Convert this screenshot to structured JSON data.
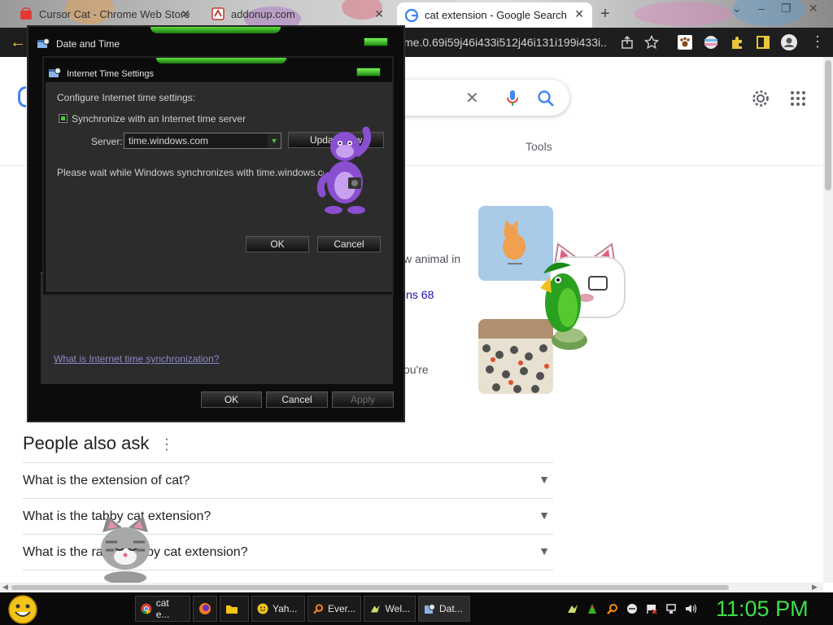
{
  "browser": {
    "tabs": [
      {
        "label": "Cursor Cat - Chrome Web Store",
        "active": false
      },
      {
        "label": "addonup.com",
        "active": false
      },
      {
        "label": "cat extension - Google Search",
        "active": true
      }
    ],
    "new_tab": "+",
    "window_controls": [
      "–",
      "❐",
      "✕"
    ],
    "url_fragment": "me.0.69i59j46i433i512j46i131i199i433i..."
  },
  "search": {
    "tools_label": "Tools",
    "clear_icon": "✕"
  },
  "result_snippets": [
    {
      "text": "w animal in",
      "link": false
    },
    {
      "text": "ins 68",
      "link": true
    },
    {
      "text": "ou're",
      "link": false
    }
  ],
  "people_also_ask": {
    "title": "People also ask",
    "menu": "⋮",
    "questions": [
      "What is the extension of cat?",
      "What is the tabby cat extension?",
      "What is the rarest tabby cat extension?"
    ]
  },
  "date_time_dialog": {
    "title": "Date and Time",
    "ok_label": "OK",
    "cancel_label": "Cancel",
    "apply_label": "Apply",
    "help_link": "What is Internet time synchronization?"
  },
  "internet_time_dialog": {
    "title": "Internet Time Settings",
    "heading": "Configure Internet time settings:",
    "sync_checkbox_label": "Synchronize with an Internet time server",
    "sync_checked": true,
    "server_label": "Server:",
    "server_value": "time.windows.com",
    "update_button": "Update now",
    "status_text": "Please wait while Windows synchronizes with time.windows.com.",
    "ok_label": "OK",
    "cancel_label": "Cancel"
  },
  "taskbar": {
    "buttons": [
      {
        "label": "cat e...",
        "icon": "chrome-icon"
      },
      {
        "label": "",
        "icon": "firefox-icon"
      },
      {
        "label": "",
        "icon": "folder-icon"
      },
      {
        "label": "Yah...",
        "icon": "smiley-icon"
      },
      {
        "label": "Ever...",
        "icon": "search-icon"
      },
      {
        "label": "Wel...",
        "icon": "bird-icon"
      },
      {
        "label": "Dat...",
        "icon": "datetime-icon"
      }
    ],
    "clock": "11:05 PM"
  },
  "colors": {
    "accent_green": "#3ee04a",
    "link_blue": "#1a0dab",
    "dialog_bg": "#0c0c0c"
  }
}
